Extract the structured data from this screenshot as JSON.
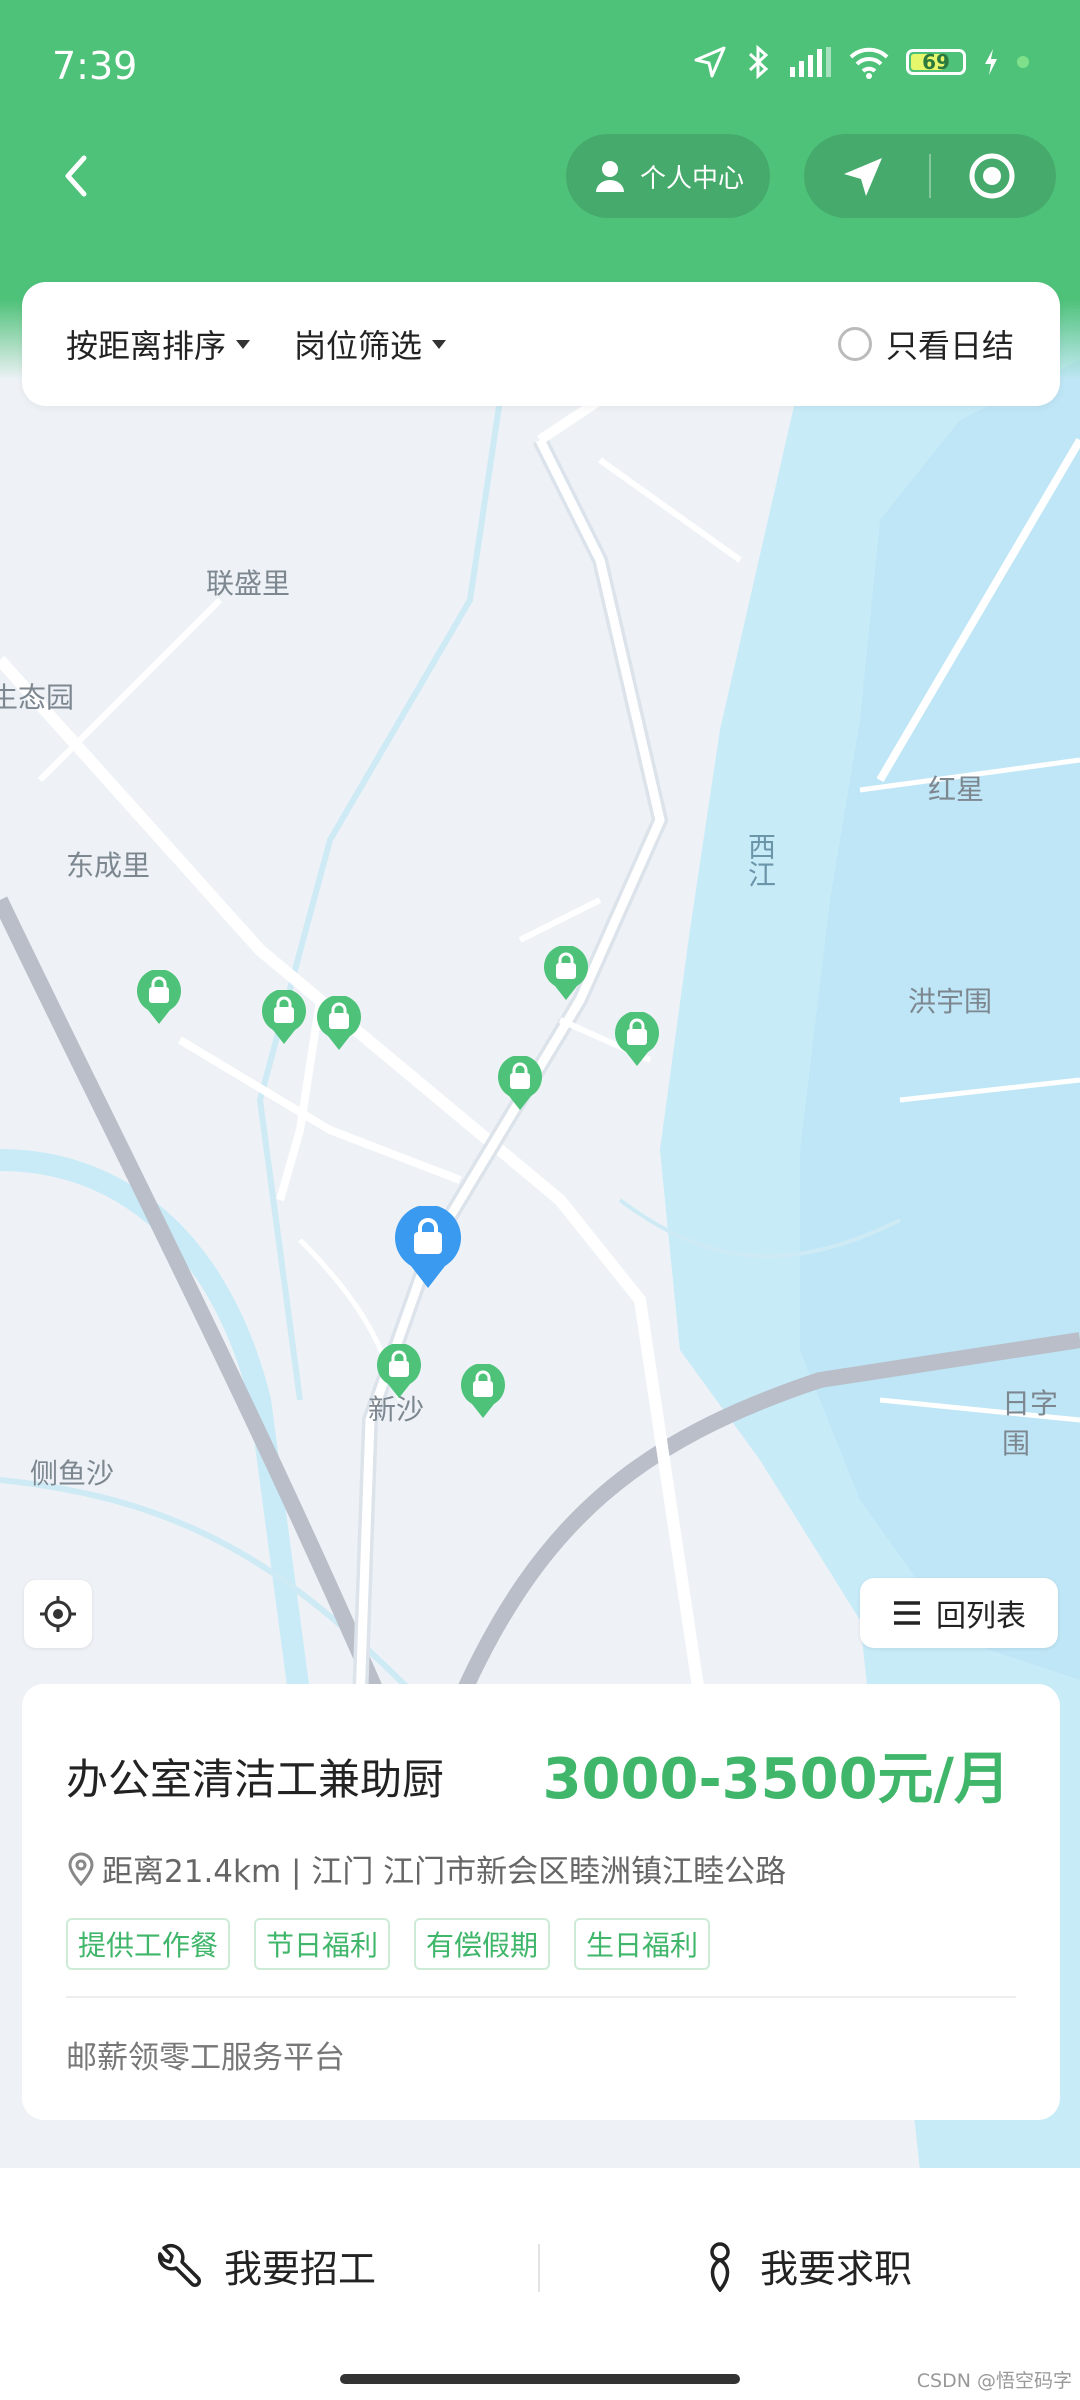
{
  "status_bar": {
    "time": "7:39",
    "battery": "69"
  },
  "header": {
    "personal_center": "个人中心"
  },
  "filters": {
    "sort": "按距离排序",
    "position_filter": "岗位筛选",
    "only_daily": "只看日结"
  },
  "map": {
    "places": [
      "联盛里",
      "生态园",
      "东成里",
      "红星",
      "洪宇围",
      "新沙",
      "侧鱼沙",
      "日字围"
    ],
    "river": "西江"
  },
  "controls": {
    "back_to_list": "回列表"
  },
  "job_card": {
    "title": "办公室清洁工兼助厨",
    "salary": "3000-3500元/月",
    "address": "距离21.4km | 江门 江门市新会区睦洲镇江睦公路",
    "tags": [
      "提供工作餐",
      "节日福利",
      "有偿假期",
      "生日福利"
    ],
    "platform": "邮薪领零工服务平台"
  },
  "bottom_nav": {
    "recruit": "我要招工",
    "job_seek": "我要求职"
  },
  "watermark": "CSDN @悟空码字",
  "colors": {
    "brand_green": "#4fc27a",
    "salary_green": "#3fb66a",
    "pin_blue": "#3a9af0",
    "river": "#bfe6f6"
  }
}
